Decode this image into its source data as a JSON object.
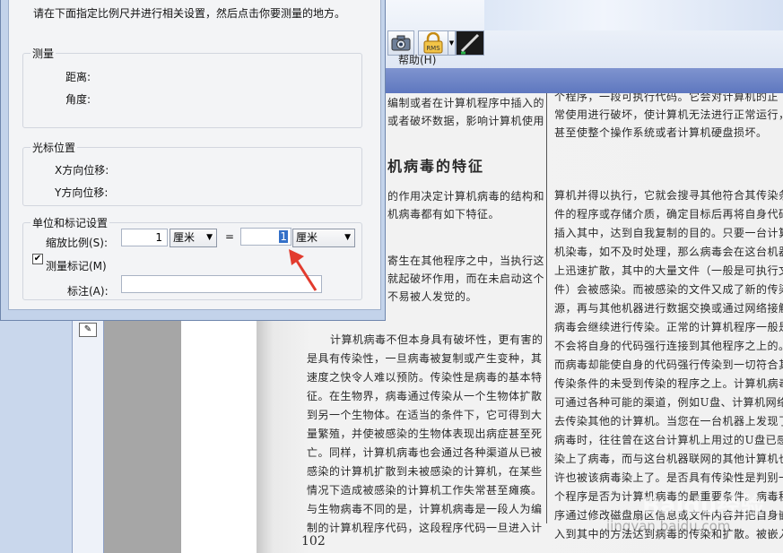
{
  "toolbar": {
    "rms_label": "RMS",
    "menu_help": "帮助(H)"
  },
  "dialog": {
    "instruction": "请在下面指定比例尺并进行相关设置，然后点击你要测量的地方。",
    "measure": {
      "title": "测量",
      "distance_label": "距离:",
      "angle_label": "角度:"
    },
    "cursor": {
      "title": "光标位置",
      "x_label": "X方向位移:",
      "y_label": "Y方向位移:"
    },
    "units": {
      "title": "单位和标记设置",
      "scale_label": "缩放比例(S):",
      "scale_value_1": "1",
      "unit_1": "厘米",
      "equals": "=",
      "scale_value_2": "1",
      "unit_2": "厘米",
      "mark_label": "测量标记(M)",
      "mark_checked": true,
      "annotation_label": "标注(A):",
      "annotation_value": ""
    }
  },
  "document": {
    "top_left_lines": [
      "编制或者在计算机程序中插入的",
      "或者破坏数据，影响计算机使用"
    ],
    "top_right_lines": [
      "个程序，一段可执行代码。它会对计算机的正",
      "常使用进行破坏，使计算机无法进行正常运行，",
      "甚至使整个操作系统或者计算机硬盘损坏。"
    ],
    "heading": "机病毒的特征",
    "left_lines_1": [
      "的作用决定计算机病毒的结构和",
      "机病毒都有如下特征。"
    ],
    "left_lines_2": [
      "寄生在其他程序之中，当执行这",
      "就起破坏作用，而在未启动这个",
      "不易被人发觉的。"
    ],
    "left_lines_3": [
      "计算机病毒不但本身具有破坏性，更有害的",
      "是具有传染性，一旦病毒被复制或产生变种，其",
      "速度之快令人难以预防。传染性是病毒的基本特",
      "征。在生物界，病毒通过传染从一个生物体扩散",
      "到另一个生物体。在适当的条件下，它可得到大",
      "量繁殖，并使被感染的生物体表现出病症甚至死",
      "亡。同样，计算机病毒也会通过各种渠道从已被",
      "感染的计算机扩散到未被感染的计算机，在某些",
      "情况下造成被感染的计算机工作失常甚至瘫痪。",
      "与生物病毒不同的是，计算机病毒是一段人为编",
      "制的计算机程序代码，这段程序代码一旦进入计"
    ],
    "right_lines": [
      "算机并得以执行，它就会搜寻其他符合其传染条",
      "件的程序或存储介质，确定目标后再将自身代码",
      "插入其中，达到自我复制的目的。只要一台计算",
      "机染毒，如不及时处理，那么病毒会在这台机器",
      "上迅速扩散，其中的大量文件（一般是可执行文",
      "件）会被感染。而被感染的文件又成了新的传染",
      "源，再与其他机器进行数据交换或通过网络接触，",
      "病毒会继续进行传染。正常的计算机程序一般是",
      "不会将自身的代码强行连接到其他程序之上的。",
      "而病毒却能使自身的代码强行传染到一切符合其",
      "传染条件的未受到传染的程序之上。计算机病毒",
      "可通过各种可能的渠道，例如U盘、计算机网络",
      "去传染其他的计算机。当您在一台机器上发现了",
      "病毒时，往往曾在这台计算机上用过的U盘已感",
      "染上了病毒，而与这台机器联网的其他计算机也",
      "许也被该病毒染上了。是否具有传染性是判别一",
      "个程序是否为计算机病毒的最重要条件。病毒程",
      "序通过修改磁盘扇区信息或文件内容并把自身嵌",
      "入到其中的方法达到病毒的传染和扩散。被嵌入"
    ],
    "page_number": "102",
    "watermark_logo": "Baidu经验",
    "watermark_url": "jingyan.baidu.com"
  }
}
